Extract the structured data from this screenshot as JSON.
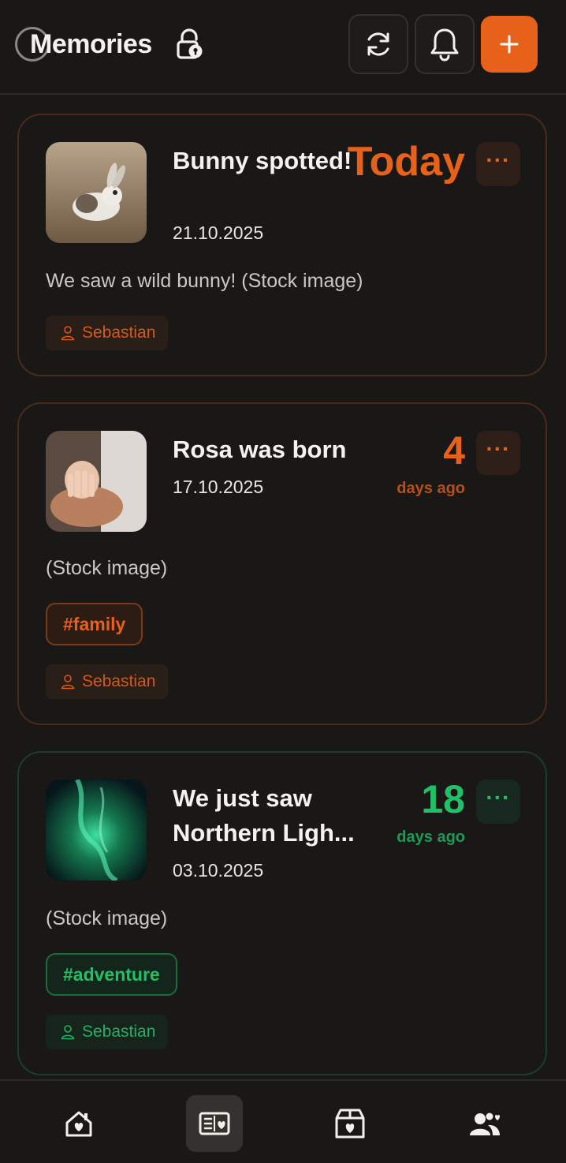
{
  "header": {
    "title": "Memories",
    "icons": {
      "logo": "logo-circle-icon",
      "lock": "lock-icon",
      "refresh": "refresh-icon",
      "bell": "bell-icon",
      "add": "plus-icon"
    }
  },
  "colors": {
    "accent": "#e8611a",
    "success": "#22c066",
    "background": "#1a1817"
  },
  "memories": [
    {
      "title": "Bunny spotted!",
      "date": "21.10.2025",
      "relative_big": "Today",
      "relative_sub": "",
      "description": "We saw a wild bunny! (Stock image)",
      "tag": "",
      "author": "Sebastian",
      "more": "···"
    },
    {
      "title": "Rosa was born",
      "date": "17.10.2025",
      "relative_big": "4",
      "relative_sub": "days ago",
      "description": "(Stock image)",
      "tag": "#family",
      "author": "Sebastian",
      "more": "···"
    },
    {
      "title": "We just saw Northern Ligh...",
      "date": "03.10.2025",
      "relative_big": "18",
      "relative_sub": "days ago",
      "description": "(Stock image)",
      "tag": "#adventure",
      "author": "Sebastian",
      "more": "···"
    }
  ],
  "bottom_nav": {
    "items": [
      {
        "icon": "home-heart-icon",
        "active": false
      },
      {
        "icon": "memories-icon",
        "active": true
      },
      {
        "icon": "box-heart-icon",
        "active": false
      },
      {
        "icon": "people-heart-icon",
        "active": false
      }
    ]
  }
}
